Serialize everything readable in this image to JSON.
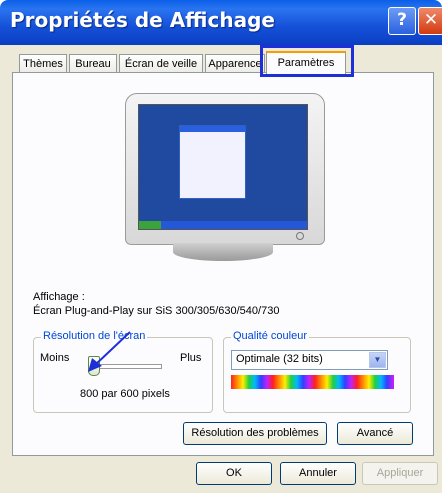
{
  "window": {
    "title": "Propriétés de Affichage",
    "help_glyph": "?",
    "close_glyph": "✕"
  },
  "tabs": [
    {
      "label": "Thèmes"
    },
    {
      "label": "Bureau"
    },
    {
      "label": "Écran de veille"
    },
    {
      "label": "Apparence"
    },
    {
      "label": "Paramètres"
    }
  ],
  "display": {
    "heading": "Affichage :",
    "device": "Écran Plug-and-Play sur SiS 300/305/630/540/730"
  },
  "resolution": {
    "group_title": "Résolution de l'écran",
    "less_label": "Moins",
    "more_label": "Plus",
    "value_text": "800 par 600 pixels",
    "slider_level": 0
  },
  "color": {
    "group_title": "Qualité couleur",
    "selected": "Optimale (32 bits)"
  },
  "buttons": {
    "troubleshoot": "Résolution des problèmes",
    "advanced": "Avancé",
    "ok": "OK",
    "cancel": "Annuler",
    "apply": "Appliquer"
  },
  "colors": {
    "highlight": "#1f2fd8",
    "arrow": "#1f2fd8",
    "title_bar": "#0a5fe8",
    "group_title": "#0046d5"
  }
}
